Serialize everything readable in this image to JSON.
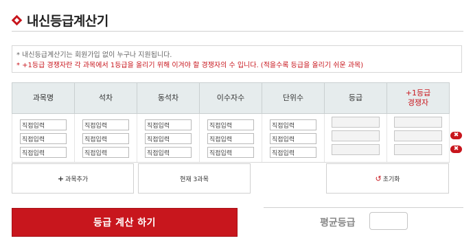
{
  "header": {
    "title": "내신등급계산기"
  },
  "notice": {
    "line1": "* 내신등급계산기는 회원가입 없이 누구나 지원됩니다.",
    "line2": "* +1등급 경쟁자란 각 과목에서 1등급을 올리기 위해 이겨야 할 경쟁자의 수 입니다. (적을수록 등급을 올리기 쉬운 과목)"
  },
  "table": {
    "headers": [
      "과목명",
      "석차",
      "동석차",
      "이수자수",
      "단위수",
      "등급",
      "+1등급\n경쟁자"
    ],
    "rows": [
      [
        "직접입력",
        "직접입력",
        "직접입력",
        "직접입력",
        "직접입력",
        "",
        ""
      ],
      [
        "직접입력",
        "직접입력",
        "직접입력",
        "직접입력",
        "직접입력",
        "",
        ""
      ],
      [
        "직접입력",
        "직접입력",
        "직접입력",
        "직접입력",
        "직접입력",
        "",
        ""
      ]
    ]
  },
  "buttons": {
    "add_subject": "과목추가",
    "current_count": "현재 3과목",
    "reset": "초기화",
    "calculate": "등급 계산 하기",
    "delete_symbol": "✖"
  },
  "average": {
    "label": "평균등급",
    "value": ""
  },
  "colors": {
    "accent": "#c8161d",
    "header_bg": "#e6eced"
  }
}
